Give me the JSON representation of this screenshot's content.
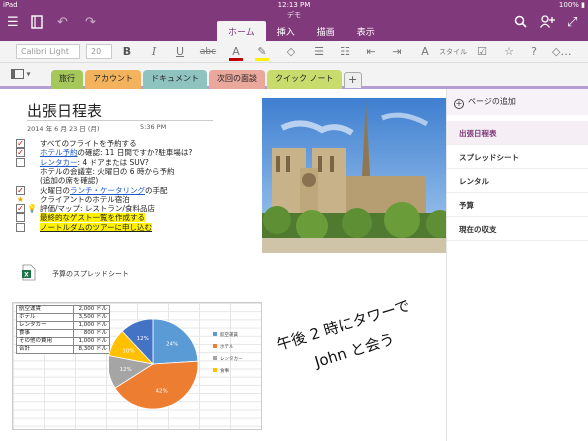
{
  "status": {
    "device": "iPad",
    "time": "12:13 PM",
    "battery": "100%"
  },
  "doc_name": "デモ",
  "ribbon_tabs": [
    {
      "label": "ホーム",
      "active": true
    },
    {
      "label": "挿入",
      "active": false
    },
    {
      "label": "描画",
      "active": false
    },
    {
      "label": "表示",
      "active": false
    }
  ],
  "icons": {
    "sidebar": "sidebar-toggle-icon",
    "notebook": "notebook-icon",
    "undo": "undo-icon",
    "redo": "redo-icon",
    "search": "search-icon",
    "share": "add-person-icon",
    "expand": "expand-icon"
  },
  "toolbar": {
    "font_name": "Calibri Light",
    "font_size": "20",
    "bold": "B",
    "italic": "I",
    "underline": "U",
    "strike": "abc",
    "font_color": "A",
    "style_label": "スタイル",
    "font_color_hex": "#c00000",
    "highlight_hex": "#fff200"
  },
  "section_tabs": [
    {
      "label": "旅行",
      "color": "#a5c85b",
      "active": true
    },
    {
      "label": "アカウント",
      "color": "#f3b35d",
      "active": false
    },
    {
      "label": "ドキュメント",
      "color": "#8fc3c0",
      "active": false
    },
    {
      "label": "次回の面談",
      "color": "#e9a89b",
      "active": false
    },
    {
      "label": "クイック ノート",
      "color": "#c8dc6e",
      "active": false
    }
  ],
  "page": {
    "title": "出張日程表",
    "date": "2014 年 6 月 23 日 (月)",
    "time": "5:36 PM",
    "lines": [
      {
        "mark": "checked",
        "parts": [
          {
            "t": "すべてのフライトを予約する"
          }
        ]
      },
      {
        "mark": "checked",
        "parts": [
          {
            "t": "ホテル予約",
            "link": true
          },
          {
            "t": "の確認: 11 日間ですか?駐車場は?"
          }
        ]
      },
      {
        "mark": "box",
        "parts": [
          {
            "t": "レンタカー",
            "link": true
          },
          {
            "t": ": 4 ドアまたは SUV?"
          }
        ]
      },
      {
        "mark": "none",
        "parts": [
          {
            "t": "ホテルの会議室: 火曜日の 6 時から予約"
          }
        ]
      },
      {
        "mark": "none",
        "parts": [
          {
            "t": "(追加の席を確認)"
          }
        ]
      },
      {
        "mark": "checked",
        "parts": [
          {
            "t": "火曜日の"
          },
          {
            "t": "ランチ・ケータリング",
            "link": true
          },
          {
            "t": "の手配"
          }
        ]
      },
      {
        "mark": "star",
        "parts": [
          {
            "t": "クライアントのホテル宿泊"
          }
        ]
      },
      {
        "mark": "checked-bulb",
        "parts": [
          {
            "t": "評価/マップ: レストラン/食料品店"
          }
        ]
      },
      {
        "mark": "box",
        "parts": [
          {
            "t": "最終的なゲスト一覧を作成する",
            "hl": true
          }
        ]
      },
      {
        "mark": "box",
        "parts": [
          {
            "t": "ノートルダムのツアーに申し込む",
            "hl": true,
            "ul": true
          }
        ]
      }
    ],
    "attachment_label": "予算のスプレッドシート",
    "handwriting_1": "午後 2 時にタワーで",
    "handwriting_2": "John と会う"
  },
  "budget": {
    "rows": [
      [
        "航空運賃",
        "2,000 ドル"
      ],
      [
        "ホテル",
        "3,500 ドル"
      ],
      [
        "レンタカー",
        "1,000 ドル"
      ],
      [
        "食事",
        "800 ドル"
      ],
      [
        "その他の費用",
        "1,000 ドル"
      ],
      [
        "合計",
        "8,300 ドル"
      ]
    ]
  },
  "chart_data": {
    "type": "pie",
    "categories": [
      "航空運賃",
      "ホテル",
      "レンタカー",
      "食事",
      "その他の費用"
    ],
    "values": [
      24,
      42,
      12,
      10,
      12
    ],
    "colors": [
      "#5b9bd5",
      "#ed7d31",
      "#a5a5a5",
      "#ffc000",
      "#4472c4"
    ],
    "legend": [
      {
        "label": "航空運賃",
        "color": "#5b9bd5"
      },
      {
        "label": "ホテル",
        "color": "#ed7d31"
      },
      {
        "label": "レンタカー",
        "color": "#a5a5a5"
      },
      {
        "label": "食事",
        "color": "#ffc000"
      }
    ],
    "legend_position": "right"
  },
  "pane": {
    "add_page": "ページの追加",
    "pages": [
      {
        "label": "出張日程表",
        "active": true
      },
      {
        "label": "スプレッドシート",
        "active": false
      },
      {
        "label": "レンタル",
        "active": false
      },
      {
        "label": "予算",
        "active": false
      },
      {
        "label": "現在の収支",
        "active": false
      }
    ]
  },
  "colors": {
    "accent": "#80397b",
    "link": "#1f58c9",
    "highlight": "#fff200"
  }
}
